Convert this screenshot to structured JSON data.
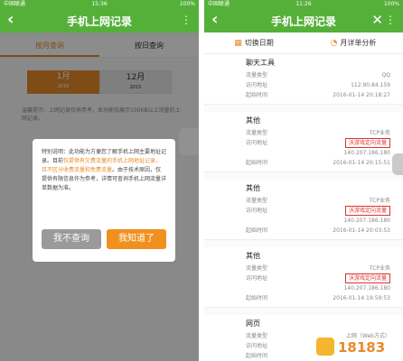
{
  "left": {
    "status": {
      "carrier": "中国联通",
      "time": "15:36",
      "right": "100%"
    },
    "title": "手机上网记录",
    "tabs": [
      {
        "label": "按月查询"
      },
      {
        "label": "按日查询"
      }
    ],
    "months": [
      {
        "month": "1月",
        "year": "2016"
      },
      {
        "month": "12月",
        "year": "2015"
      }
    ],
    "note": "温馨提示：上网记录仅供参考，本功能仅展示100KB以上流量的上网记录。",
    "dialog": {
      "message_a": "特别说明：此功能为方便您了解手机上网主要地址记录。目前",
      "highlight": "仅提供有欠费流量的手机上网地址记录，且不区分收费流量和免费流量",
      "message_b": "。由于技术原因，仅提供有限信息作为参考，详情可查询手机上网流量详单数据为准。",
      "no_button": "我不查询",
      "yes_button": "我知道了"
    }
  },
  "right": {
    "status": {
      "carrier": "中国联通",
      "time": "11:26",
      "right": "100%"
    },
    "title": "手机上网记录",
    "tools": [
      {
        "label": "切换日期",
        "icon": "calendar-icon"
      },
      {
        "label": "月详单分析",
        "icon": "chart-icon"
      }
    ],
    "records": [
      {
        "title": "聊天工具",
        "rows": [
          {
            "label": "流量类型",
            "value": "QQ",
            "flag": false
          },
          {
            "label": "访问地址",
            "value": "112.90.84.159",
            "flag": false
          },
          {
            "label": "起始时间",
            "value": "2016-01-14 20:18:27",
            "flag": false
          }
        ]
      },
      {
        "title": "其他",
        "rows": [
          {
            "label": "流量类型",
            "value": "TCP业务",
            "flag": false
          },
          {
            "label": "访问地址",
            "value": "沃游戏定向流量",
            "flag": true
          },
          {
            "label": "",
            "value": "140.207.186.180",
            "flag": false
          },
          {
            "label": "起始时间",
            "value": "2016-01-14 20:15:51",
            "flag": false
          }
        ]
      },
      {
        "title": "其他",
        "rows": [
          {
            "label": "流量类型",
            "value": "TCP业务",
            "flag": false
          },
          {
            "label": "访问地址",
            "value": "沃游戏定向流量",
            "flag": true
          },
          {
            "label": "",
            "value": "140.207.186.180",
            "flag": false
          },
          {
            "label": "起始时间",
            "value": "2016-01-14 20:03:53",
            "flag": false
          }
        ]
      },
      {
        "title": "其他",
        "rows": [
          {
            "label": "流量类型",
            "value": "TCP业务",
            "flag": false
          },
          {
            "label": "访问地址",
            "value": "沃游戏定向流量",
            "flag": true
          },
          {
            "label": "",
            "value": "140.207.186.180",
            "flag": false
          },
          {
            "label": "起始时间",
            "value": "2016-01-14 19:59:53",
            "flag": false
          }
        ]
      },
      {
        "title": "网页",
        "rows": [
          {
            "label": "流量类型",
            "value": "上网（Web方式）",
            "flag": false
          },
          {
            "label": "访问地址",
            "value": "",
            "flag": false
          },
          {
            "label": "起始时间",
            "value": "",
            "flag": false
          }
        ]
      }
    ]
  },
  "watermark": "18183",
  "colors": {
    "green": "#55b03a",
    "orange": "#e88a2a",
    "flag_red": "#d33333"
  }
}
